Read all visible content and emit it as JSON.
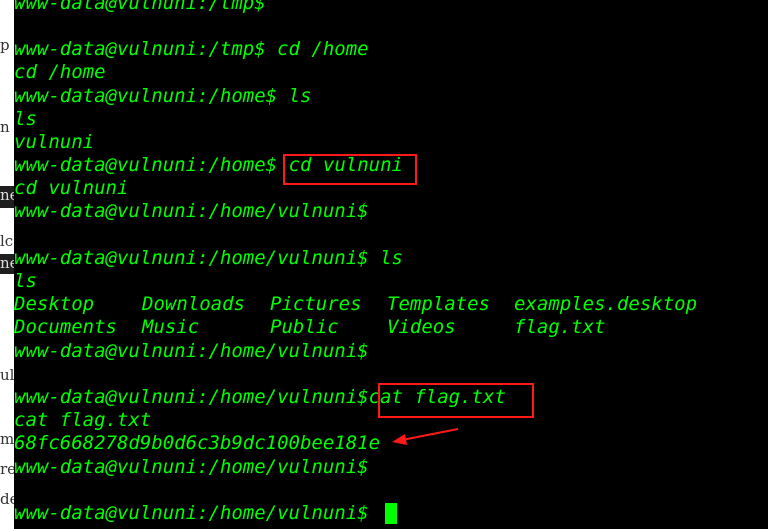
{
  "terminal": {
    "lines": [
      {
        "text": "www-data@vulnuni:/tmp$"
      },
      {
        "text": ""
      },
      {
        "text": "www-data@vulnuni:/tmp$ cd /home"
      },
      {
        "text": "cd /home"
      },
      {
        "text": "www-data@vulnuni:/home$ ls"
      },
      {
        "text": "ls"
      },
      {
        "text": "vulnuni"
      },
      {
        "prompt": "www-data@vulnuni:/home$",
        "command": "cd vulnuni"
      },
      {
        "text": "cd vulnuni"
      },
      {
        "text": "www-data@vulnuni:/home/vulnuni$"
      },
      {
        "text": ""
      },
      {
        "text": "www-data@vulnuni:/home/vulnuni$ ls"
      },
      {
        "text": "ls"
      },
      {
        "cells": [
          "Desktop",
          "Downloads",
          "Pictures",
          "Templates",
          "examples.desktop"
        ]
      },
      {
        "cells": [
          "Documents",
          "Music",
          "Public",
          "Videos",
          "flag.txt"
        ]
      },
      {
        "text": "www-data@vulnuni:/home/vulnuni$"
      },
      {
        "text": ""
      },
      {
        "prompt": "www-data@vulnuni:/home/vulnuni$",
        "command": "cat flag.txt"
      },
      {
        "text": "cat flag.txt"
      },
      {
        "text": "68fc668278d9b0d6c3b9dc100bee181e"
      },
      {
        "text": "www-data@vulnuni:/home/vulnuni$"
      },
      {
        "text": ""
      },
      {
        "text": "www-data@vulnuni:/home/vulnuni$"
      }
    ]
  },
  "background_fragments": [
    "p",
    "n",
    "ne",
    "lc",
    "ne",
    "ula",
    "m",
    "re",
    "de"
  ],
  "colors": {
    "terminal_bg": "#000000",
    "text": "#00ff00",
    "highlight": "#ff1a1a",
    "arrow": "#ff1a1a"
  }
}
